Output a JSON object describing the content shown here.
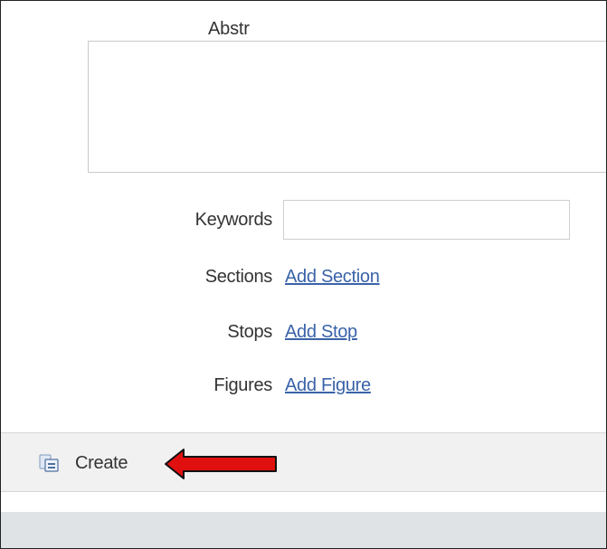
{
  "form": {
    "abstract_label": "Abstr",
    "abstract_value": "",
    "keywords_label": "Keywords",
    "keywords_value": "",
    "sections_label": "Sections",
    "sections_link": "Add Section",
    "stops_label": "Stops",
    "stops_link": "Add Stop",
    "figures_label": "Figures",
    "figures_link": "Add Figure"
  },
  "footer": {
    "create_label": "Create",
    "create_icon": "create-document-icon",
    "annotation_arrow": "red-arrow-icon"
  },
  "colors": {
    "link": "#3a63a8",
    "arrow": "#e01010",
    "footer_bg": "#f1f1f1",
    "bottom_bg": "#e0e3e6"
  }
}
